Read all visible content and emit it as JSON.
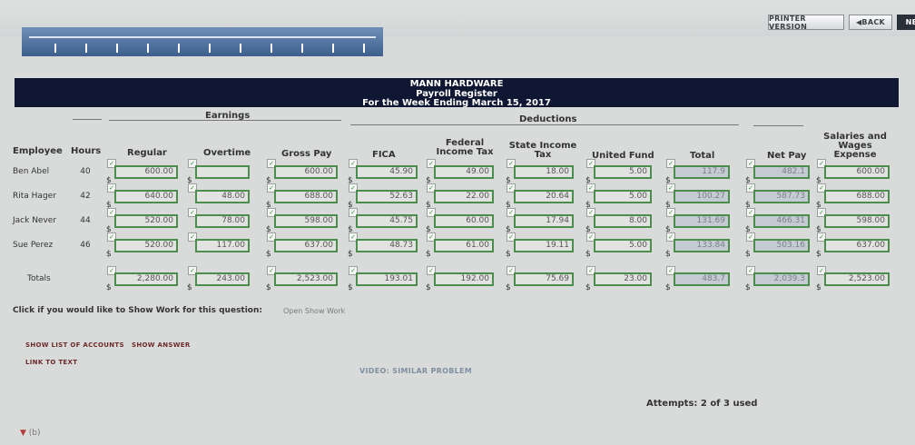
{
  "nav": {
    "printer": "PRINTER VERSION",
    "back": "◀BACK",
    "next": "NE"
  },
  "banner": {
    "company": "MANN HARDWARE",
    "doc": "Payroll Register",
    "period": "For the Week Ending March 15, 2017"
  },
  "groups": {
    "earnings": "Earnings",
    "deductions": "Deductions"
  },
  "columns": {
    "employee": "Employee",
    "hours": "Hours",
    "regular": "Regular",
    "overtime": "Overtime",
    "gross": "Gross Pay",
    "fica": "FICA",
    "federal": [
      "Federal",
      "Income Tax"
    ],
    "state": [
      "State Income",
      "Tax"
    ],
    "united": "United Fund",
    "total": "Total",
    "net": "Net Pay",
    "salaries": [
      "Salaries and",
      "Wages",
      "Expense"
    ]
  },
  "rows": [
    {
      "name": "Ben Abel",
      "hours": "40",
      "values": [
        "600.00",
        "",
        "600.00",
        "45.90",
        "49.00",
        "18.00",
        "5.00",
        "117.9",
        "482.1",
        "600.00"
      ]
    },
    {
      "name": "Rita Hager",
      "hours": "42",
      "values": [
        "640.00",
        "48.00",
        "688.00",
        "52.63",
        "22.00",
        "20.64",
        "5.00",
        "100.27",
        "587.73",
        "688.00"
      ]
    },
    {
      "name": "Jack Never",
      "hours": "44",
      "values": [
        "520.00",
        "78.00",
        "598.00",
        "45.75",
        "60.00",
        "17.94",
        "8.00",
        "131.69",
        "466.31",
        "598.00"
      ]
    },
    {
      "name": "Sue Perez",
      "hours": "46",
      "values": [
        "520.00",
        "117.00",
        "637.00",
        "48.73",
        "61.00",
        "19.11",
        "5.00",
        "133.84",
        "503.16",
        "637.00"
      ]
    },
    {
      "name": "Totals",
      "hours": "",
      "values": [
        "2,280.00",
        "243.00",
        "2,523.00",
        "193.01",
        "192.00",
        "75.69",
        "23.00",
        "483.7",
        "2,039.3",
        "2,523.00"
      ]
    }
  ],
  "work": {
    "prompt": "Click if you would like to Show Work for this question:",
    "link": "Open Show Work"
  },
  "links": {
    "accounts": "SHOW LIST OF ACCOUNTS",
    "answer": "SHOW ANSWER",
    "text": "LINK TO TEXT",
    "video": "VIDEO: SIMILAR PROBLEM"
  },
  "attempts": "Attempts: 2 of 3 used",
  "part": "(b)",
  "colors": {
    "banner": "#0f1733",
    "box_border": "#4c8c4c",
    "check": "#2f8f2f"
  }
}
